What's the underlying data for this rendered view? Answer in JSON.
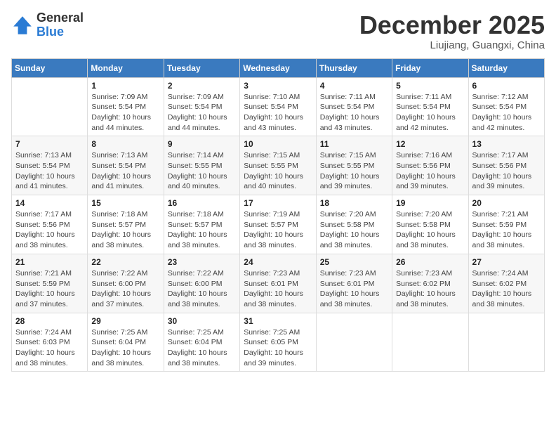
{
  "header": {
    "logo_general": "General",
    "logo_blue": "Blue",
    "month_title": "December 2025",
    "location": "Liujiang, Guangxi, China"
  },
  "weekdays": [
    "Sunday",
    "Monday",
    "Tuesday",
    "Wednesday",
    "Thursday",
    "Friday",
    "Saturday"
  ],
  "weeks": [
    [
      {
        "day": "",
        "info": ""
      },
      {
        "day": "1",
        "info": "Sunrise: 7:09 AM\nSunset: 5:54 PM\nDaylight: 10 hours\nand 44 minutes."
      },
      {
        "day": "2",
        "info": "Sunrise: 7:09 AM\nSunset: 5:54 PM\nDaylight: 10 hours\nand 44 minutes."
      },
      {
        "day": "3",
        "info": "Sunrise: 7:10 AM\nSunset: 5:54 PM\nDaylight: 10 hours\nand 43 minutes."
      },
      {
        "day": "4",
        "info": "Sunrise: 7:11 AM\nSunset: 5:54 PM\nDaylight: 10 hours\nand 43 minutes."
      },
      {
        "day": "5",
        "info": "Sunrise: 7:11 AM\nSunset: 5:54 PM\nDaylight: 10 hours\nand 42 minutes."
      },
      {
        "day": "6",
        "info": "Sunrise: 7:12 AM\nSunset: 5:54 PM\nDaylight: 10 hours\nand 42 minutes."
      }
    ],
    [
      {
        "day": "7",
        "info": "Sunrise: 7:13 AM\nSunset: 5:54 PM\nDaylight: 10 hours\nand 41 minutes."
      },
      {
        "day": "8",
        "info": "Sunrise: 7:13 AM\nSunset: 5:54 PM\nDaylight: 10 hours\nand 41 minutes."
      },
      {
        "day": "9",
        "info": "Sunrise: 7:14 AM\nSunset: 5:55 PM\nDaylight: 10 hours\nand 40 minutes."
      },
      {
        "day": "10",
        "info": "Sunrise: 7:15 AM\nSunset: 5:55 PM\nDaylight: 10 hours\nand 40 minutes."
      },
      {
        "day": "11",
        "info": "Sunrise: 7:15 AM\nSunset: 5:55 PM\nDaylight: 10 hours\nand 39 minutes."
      },
      {
        "day": "12",
        "info": "Sunrise: 7:16 AM\nSunset: 5:56 PM\nDaylight: 10 hours\nand 39 minutes."
      },
      {
        "day": "13",
        "info": "Sunrise: 7:17 AM\nSunset: 5:56 PM\nDaylight: 10 hours\nand 39 minutes."
      }
    ],
    [
      {
        "day": "14",
        "info": "Sunrise: 7:17 AM\nSunset: 5:56 PM\nDaylight: 10 hours\nand 38 minutes."
      },
      {
        "day": "15",
        "info": "Sunrise: 7:18 AM\nSunset: 5:57 PM\nDaylight: 10 hours\nand 38 minutes."
      },
      {
        "day": "16",
        "info": "Sunrise: 7:18 AM\nSunset: 5:57 PM\nDaylight: 10 hours\nand 38 minutes."
      },
      {
        "day": "17",
        "info": "Sunrise: 7:19 AM\nSunset: 5:57 PM\nDaylight: 10 hours\nand 38 minutes."
      },
      {
        "day": "18",
        "info": "Sunrise: 7:20 AM\nSunset: 5:58 PM\nDaylight: 10 hours\nand 38 minutes."
      },
      {
        "day": "19",
        "info": "Sunrise: 7:20 AM\nSunset: 5:58 PM\nDaylight: 10 hours\nand 38 minutes."
      },
      {
        "day": "20",
        "info": "Sunrise: 7:21 AM\nSunset: 5:59 PM\nDaylight: 10 hours\nand 38 minutes."
      }
    ],
    [
      {
        "day": "21",
        "info": "Sunrise: 7:21 AM\nSunset: 5:59 PM\nDaylight: 10 hours\nand 37 minutes."
      },
      {
        "day": "22",
        "info": "Sunrise: 7:22 AM\nSunset: 6:00 PM\nDaylight: 10 hours\nand 37 minutes."
      },
      {
        "day": "23",
        "info": "Sunrise: 7:22 AM\nSunset: 6:00 PM\nDaylight: 10 hours\nand 38 minutes."
      },
      {
        "day": "24",
        "info": "Sunrise: 7:23 AM\nSunset: 6:01 PM\nDaylight: 10 hours\nand 38 minutes."
      },
      {
        "day": "25",
        "info": "Sunrise: 7:23 AM\nSunset: 6:01 PM\nDaylight: 10 hours\nand 38 minutes."
      },
      {
        "day": "26",
        "info": "Sunrise: 7:23 AM\nSunset: 6:02 PM\nDaylight: 10 hours\nand 38 minutes."
      },
      {
        "day": "27",
        "info": "Sunrise: 7:24 AM\nSunset: 6:02 PM\nDaylight: 10 hours\nand 38 minutes."
      }
    ],
    [
      {
        "day": "28",
        "info": "Sunrise: 7:24 AM\nSunset: 6:03 PM\nDaylight: 10 hours\nand 38 minutes."
      },
      {
        "day": "29",
        "info": "Sunrise: 7:25 AM\nSunset: 6:04 PM\nDaylight: 10 hours\nand 38 minutes."
      },
      {
        "day": "30",
        "info": "Sunrise: 7:25 AM\nSunset: 6:04 PM\nDaylight: 10 hours\nand 38 minutes."
      },
      {
        "day": "31",
        "info": "Sunrise: 7:25 AM\nSunset: 6:05 PM\nDaylight: 10 hours\nand 39 minutes."
      },
      {
        "day": "",
        "info": ""
      },
      {
        "day": "",
        "info": ""
      },
      {
        "day": "",
        "info": ""
      }
    ]
  ]
}
